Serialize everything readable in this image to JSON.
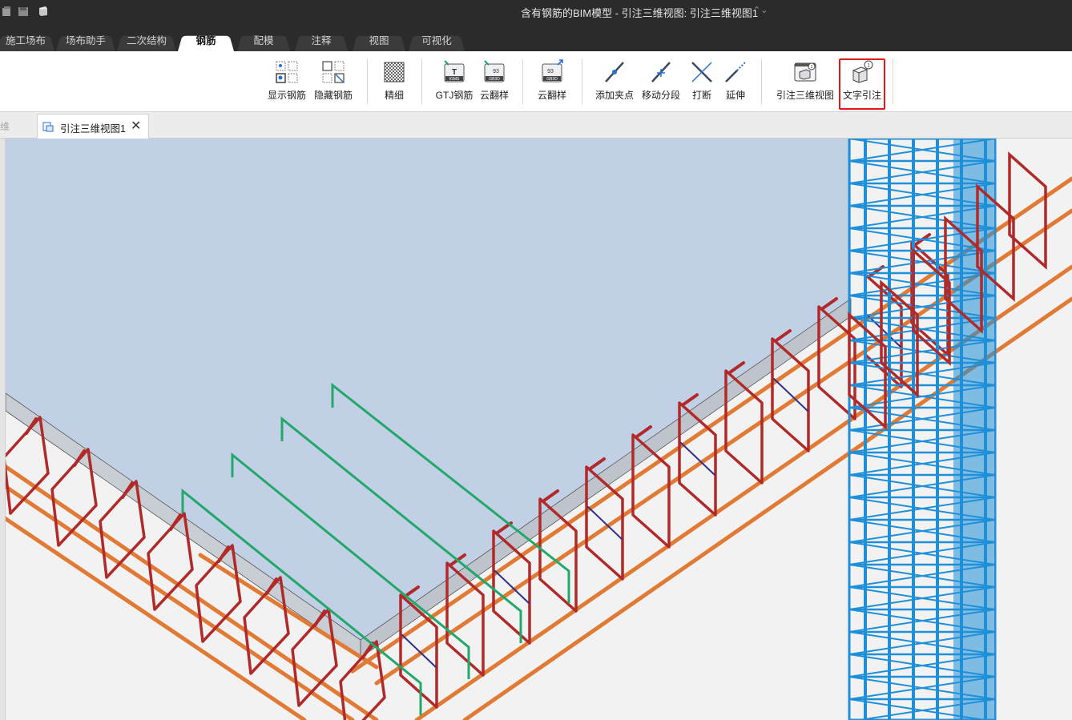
{
  "window": {
    "title": "含有钢筋的BIM模型 - 引注三维视图: 引注三维视图1",
    "title_caret": "⌃⌄"
  },
  "quick_access": [
    "file-icon",
    "save-icon",
    "cube-icon"
  ],
  "ribbon_tabs": [
    {
      "label": "施工场布",
      "active": false
    },
    {
      "label": "场布助手",
      "active": false
    },
    {
      "label": "二次结构",
      "active": false
    },
    {
      "label": "钢筋",
      "active": true
    },
    {
      "label": "配模",
      "active": false
    },
    {
      "label": "注释",
      "active": false
    },
    {
      "label": "视图",
      "active": false
    },
    {
      "label": "可视化",
      "active": false
    }
  ],
  "ribbon": {
    "show_rebar": {
      "label": "显示钢筋",
      "icon": "show-rebar-icon"
    },
    "hide_rebar": {
      "label": "隐藏钢筋",
      "icon": "hide-rebar-icon"
    },
    "fine": {
      "label": "精细",
      "icon": "fine-detail-icon"
    },
    "gtj_rebar": {
      "label": "GTJ钢筋",
      "icon": "gtj-rebar-icon",
      "badge": "IGMS"
    },
    "cloud_sample_1": {
      "label": "云翻样",
      "icon": "cloud-sample-icon",
      "badge": "GB3D"
    },
    "cloud_sample_2": {
      "label": "云翻样",
      "icon": "cloud-sample-export-icon",
      "badge": "GB3D"
    },
    "add_grip": {
      "label": "添加夹点",
      "icon": "add-grip-icon"
    },
    "move_segment": {
      "label": "移动分段",
      "icon": "move-segment-icon"
    },
    "break": {
      "label": "打断",
      "icon": "break-icon"
    },
    "extend": {
      "label": "延伸",
      "icon": "extend-icon"
    },
    "annot_3d_view": {
      "label": "引注三维视图",
      "icon": "annotation-3d-view-icon"
    },
    "text_annot": {
      "label": "文字引注",
      "icon": "text-annotation-icon",
      "highlighted": true
    }
  },
  "doc_tabs": {
    "previous_partial": "维",
    "active": "引注三维视图1"
  },
  "colors": {
    "slab_top": "#c2d0e6",
    "slab_edge": "#c9cdd4",
    "stirrup": "#b02a2a",
    "longitudinal": "#e07a35",
    "slab_bar": "#21a86a",
    "tie": "#30308a",
    "column": "#1f8fd8",
    "highlight": "#e11818"
  }
}
